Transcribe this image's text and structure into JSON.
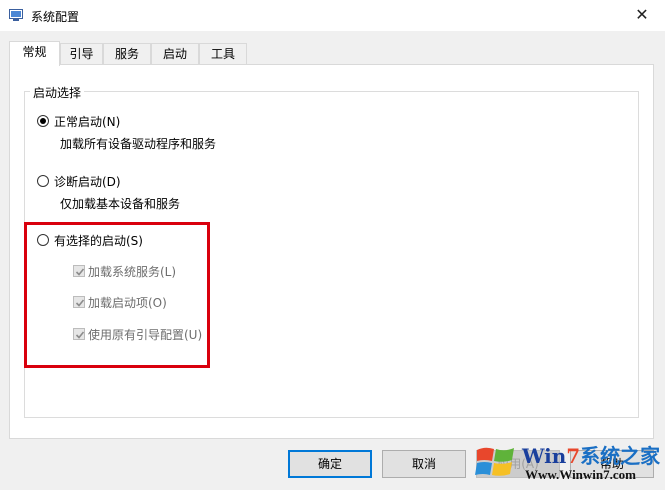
{
  "window": {
    "title": "系统配置",
    "close_glyph": "✕"
  },
  "tabs": [
    {
      "label": "常规",
      "active": true
    },
    {
      "label": "引导",
      "active": false
    },
    {
      "label": "服务",
      "active": false
    },
    {
      "label": "启动",
      "active": false
    },
    {
      "label": "工具",
      "active": false
    }
  ],
  "startup_selection": {
    "legend": "启动选择",
    "options": [
      {
        "label": "正常启动(N)",
        "description": "加载所有设备驱动程序和服务",
        "selected": true
      },
      {
        "label": "诊断启动(D)",
        "description": "仅加载基本设备和服务",
        "selected": false
      },
      {
        "label": "有选择的启动(S)",
        "selected": false
      }
    ],
    "selective_items": [
      {
        "label": "加载系统服务(L)",
        "checked": true,
        "enabled": false
      },
      {
        "label": "加载启动项(O)",
        "checked": true,
        "enabled": false
      },
      {
        "label": "使用原有引导配置(U)",
        "checked": true,
        "enabled": false
      }
    ]
  },
  "buttons": {
    "ok": "确定",
    "cancel": "取消",
    "apply": "应用(A)",
    "help": "帮助"
  },
  "watermark": {
    "brand_prefix": "Win",
    "brand_seven": "7",
    "brand_suffix": "系统之家",
    "url": "Www.Winwin7.com"
  },
  "colors": {
    "highlight": "#d9000d",
    "default_button_border": "#0078d7",
    "disabled_text": "#6d6d6d"
  }
}
